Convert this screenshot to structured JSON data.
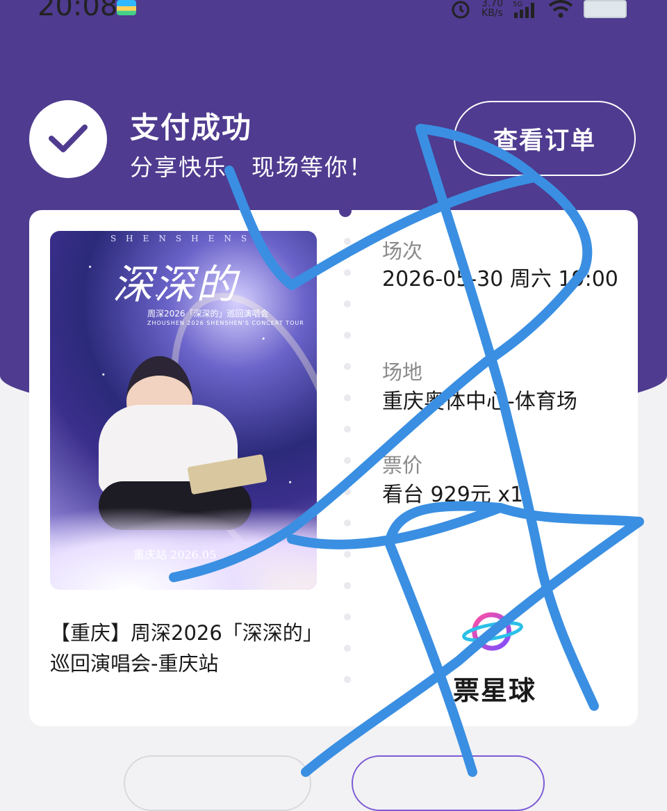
{
  "status_bar": {
    "time": "20:08",
    "speed": "3.70\nKB/s",
    "network": "5G"
  },
  "header": {
    "title": "支付成功",
    "subtitle": "分享快乐，现场等你！",
    "order_button": "查看订单"
  },
  "ticket": {
    "poster": {
      "spaced_text": "SHENSHENS",
      "title": "深深的",
      "subtitle": "周深2026「深深的」巡回演唱会",
      "subtitle_en": "ZHOUSHEN 2026 SHENSHEN'S CONCERT TOUR",
      "station": "重庆站 2026.05"
    },
    "event_name": "【重庆】周深2026「深深的」巡回演唱会-重庆站",
    "session_label": "场次",
    "session_value": "2026-05-30 周六 19:00",
    "venue_label": "场地",
    "venue_value": "重庆奥体中心-体育场",
    "price_label": "票价",
    "price_value": "看台 929元 x1",
    "brand_name": "票星球"
  },
  "colors": {
    "hero": "#4f3b8f",
    "accent": "#7c5bd6",
    "scribble": "#3a8fe2"
  },
  "icons": [
    "alarm-icon",
    "signal-icon",
    "wifi-icon",
    "battery-icon",
    "checkmark-icon",
    "planet-logo-icon"
  ]
}
